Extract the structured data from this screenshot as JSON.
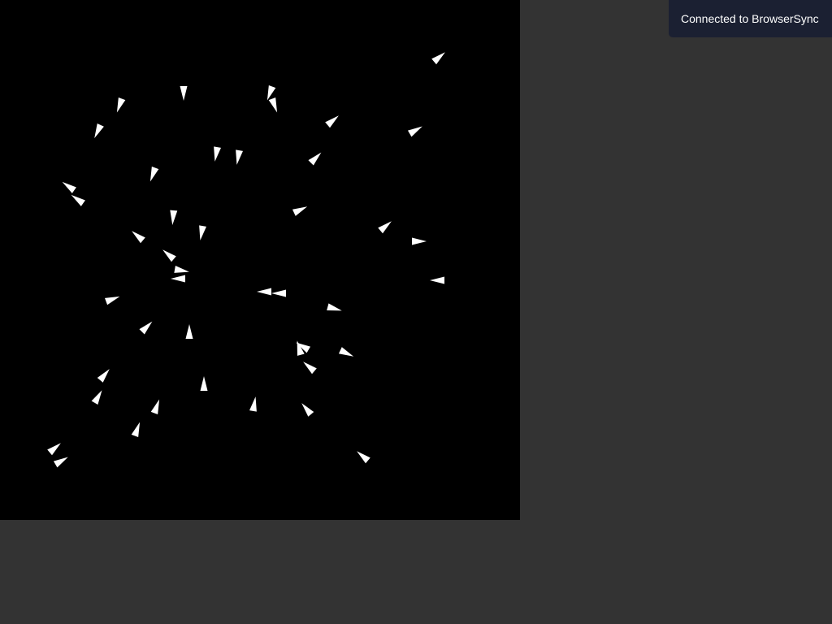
{
  "page": {
    "background_color": "#333333"
  },
  "canvas": {
    "background_color": "#000000",
    "boid_color": "#ffffff",
    "boid_shape": "triangle"
  },
  "notification": {
    "text": "Connected to BrowserSync",
    "background_color": "#1b2032",
    "text_color": "#ffffff"
  }
}
